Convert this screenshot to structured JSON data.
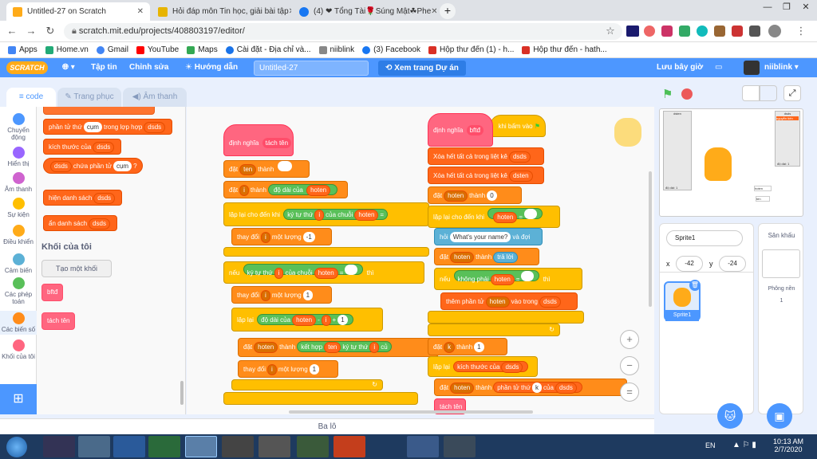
{
  "browser": {
    "tabs": [
      {
        "label": "Untitled-27 on Scratch",
        "icon_color": "#ffab19"
      },
      {
        "label": "Hỏi đáp môn Tin học, giải bài tập",
        "icon_color": "#e7b400"
      },
      {
        "label": "(4) ❤ Tổng Tài🌹Súng Mật☘Phe",
        "icon_color": "#1877f2"
      }
    ],
    "new_tab": "+",
    "window_controls": [
      "—",
      "❐",
      "✕"
    ],
    "url": "scratch.mit.edu/projects/408803197/editor/",
    "bookmarks": [
      "Apps",
      "Home.vn",
      "Gmail",
      "YouTube",
      "Maps",
      "Cài đặt - Địa chỉ và...",
      "niiblink",
      "(3) Facebook",
      "Hộp thư đến (1) - h...",
      "Hộp thư đến - hath..."
    ]
  },
  "menu": {
    "logo": "SCRATCH",
    "file": "Tập tin",
    "edit": "Chỉnh sửa",
    "tutorials": "Hướng dẫn",
    "title": "Untitled-27",
    "see_project": "Xem trang Dự án",
    "save_now": "Lưu bây giờ",
    "username": "niiblink"
  },
  "tabs": {
    "code": "code",
    "costumes": "Trang phục",
    "sounds": "Âm thanh"
  },
  "categories": [
    {
      "label": "Chuyển động",
      "color": "#4c97ff"
    },
    {
      "label": "Hiển thị",
      "color": "#9966ff"
    },
    {
      "label": "Âm thanh",
      "color": "#cf63cf"
    },
    {
      "label": "Sự kiện",
      "color": "#ffbf00"
    },
    {
      "label": "Điều khiển",
      "color": "#ffab19"
    },
    {
      "label": "Cảm biến",
      "color": "#5cb1d6"
    },
    {
      "label": "Các phép toán",
      "color": "#59c059"
    },
    {
      "label": "Các biến số",
      "color": "#ff8c1a"
    },
    {
      "label": "Khối của tôi",
      "color": "#ff6680"
    }
  ],
  "palette": {
    "b1": "phần tử thứ",
    "b1v": "cụm",
    "b1a": "trong lợp hợp",
    "b1d": "dsds",
    "b2": "kích thước của",
    "b2d": "dsds",
    "b3d": "dsds",
    "b3": "chứa phần tử",
    "b3v": "cụm",
    "b4": "hiện danh sách",
    "b4d": "dsds",
    "b5": "ẩn danh sách",
    "b5d": "dsds",
    "heading": "Khối của tôi",
    "make_block": "Tạo một khối",
    "custom1": "bftđ",
    "custom2": "tách tên"
  },
  "script1": {
    "define": "định nghĩa",
    "define_name": "tách tên",
    "s1": "đặt",
    "s1v": "ten",
    "s1b": "thành",
    "s2": "đặt",
    "s2v": "i",
    "s2b": "thành",
    "s2c": "độ dài của",
    "s2d": "hoten",
    "s3": "lặp lại cho đến khi",
    "s3b": "ký tự thứ",
    "s3c": "i",
    "s3d": "của chuỗi",
    "s3e": "hoten",
    "s3f": "=",
    "s4": "thay đổi",
    "s4v": "i",
    "s4b": "một lượng",
    "s4c": "-1",
    "s5": "nếu",
    "s5b": "ký tự thứ",
    "s5c": "i",
    "s5d": "của chuỗi",
    "s5e": "hoten",
    "s5f": "=",
    "s5g": "thì",
    "s6": "thay đổi",
    "s6v": "i",
    "s6b": "một lượng",
    "s6c": "1",
    "s7": "lặp lại",
    "s7b": "độ dài của",
    "s7c": "hoten",
    "s7d": "-",
    "s7e": "i",
    "s7f": "+",
    "s7g": "1",
    "s8": "đặt",
    "s8v": "hoten",
    "s8b": "thành",
    "s8c": "kết hợp",
    "s8d": "ten",
    "s8e": "ký tự thứ",
    "s8f": "i",
    "s8g": "củ",
    "s9": "thay đổi",
    "s9v": "i",
    "s9b": "một lượng",
    "s9c": "1",
    "loop_arrow": "↻"
  },
  "script2": {
    "define": "định nghĩa",
    "define_name": "bftđ",
    "hat": "khi bấm vào",
    "c1": "Xóa hết tất cả trong liệt kê",
    "c1v": "dsds",
    "c2": "Xóa hết tất cả trong liệt kê",
    "c2v": "dsten",
    "c3": "đặt",
    "c3v": "hoten",
    "c3b": "thành",
    "c3c": "0",
    "c4": "lặp lại cho đến khi",
    "c4v": "hoten",
    "c4b": "=",
    "c5": "hỏi",
    "c5v": "What's your name?",
    "c5b": "và đợi",
    "c6": "đặt",
    "c6v": "hoten",
    "c6b": "thành",
    "c6c": "trả lời",
    "c7": "nếu",
    "c7b": "không phải",
    "c7c": "hoten",
    "c7d": "=",
    "c7e": "thì",
    "c8": "thêm phần tử",
    "c8v": "hoten",
    "c8b": "vào trong",
    "c8c": "dsds",
    "c9": "đặt",
    "c9v": "k",
    "c9b": "thành",
    "c9c": "1",
    "c10": "lặp lại",
    "c10b": "kích thước của",
    "c10c": "dsds",
    "c11": "đặt",
    "c11v": "hoten",
    "c11b": "thành",
    "c11c": "phần tử thứ",
    "c11d": "k",
    "c11e": "của",
    "c11f": "dsds",
    "c12": "tách tên"
  },
  "zoom": {
    "in": "+",
    "out": "−",
    "reset": "="
  },
  "backpack": "Ba lô",
  "stage": {
    "monitor1_label": "dsten",
    "monitor2_label": "dsds",
    "monitor_len1": "độ dài: 1",
    "monitor_len2": "độ dài: 1",
    "monitor_item": "nguyễn tiến",
    "var1": "hoten",
    "var2": "ten"
  },
  "sprite": {
    "name": "Sprite1",
    "x_label": "x",
    "x": "-42",
    "y_label": "y",
    "y": "-24",
    "thumb_label": "Sprite1"
  },
  "stage_panel": {
    "title": "Sân khấu",
    "backdrops_label": "Phông nền",
    "backdrops": "1"
  },
  "taskbar": {
    "lang": "EN",
    "time": "10:13 AM",
    "date": "2/7/2020"
  }
}
